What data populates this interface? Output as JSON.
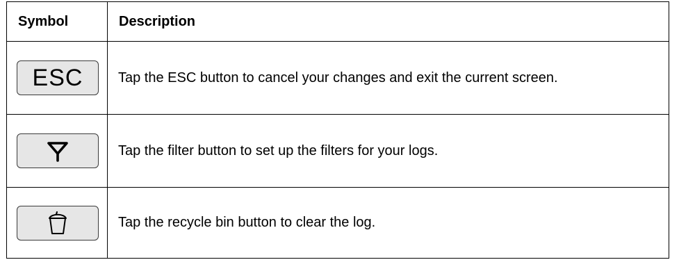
{
  "table": {
    "headers": {
      "symbol": "Symbol",
      "description": "Description"
    },
    "rows": [
      {
        "symbol_type": "text-button",
        "symbol_text": "ESC",
        "description": "Tap the ESC button to cancel your changes and exit the current screen."
      },
      {
        "symbol_type": "icon-button",
        "icon": "filter-icon",
        "description": "Tap the filter button to set up the filters for your logs."
      },
      {
        "symbol_type": "icon-button",
        "icon": "recycle-bin-icon",
        "description": "Tap the recycle bin button to clear the log."
      }
    ]
  },
  "colors": {
    "button_fill": "#e6e6e6",
    "border": "#000000"
  }
}
